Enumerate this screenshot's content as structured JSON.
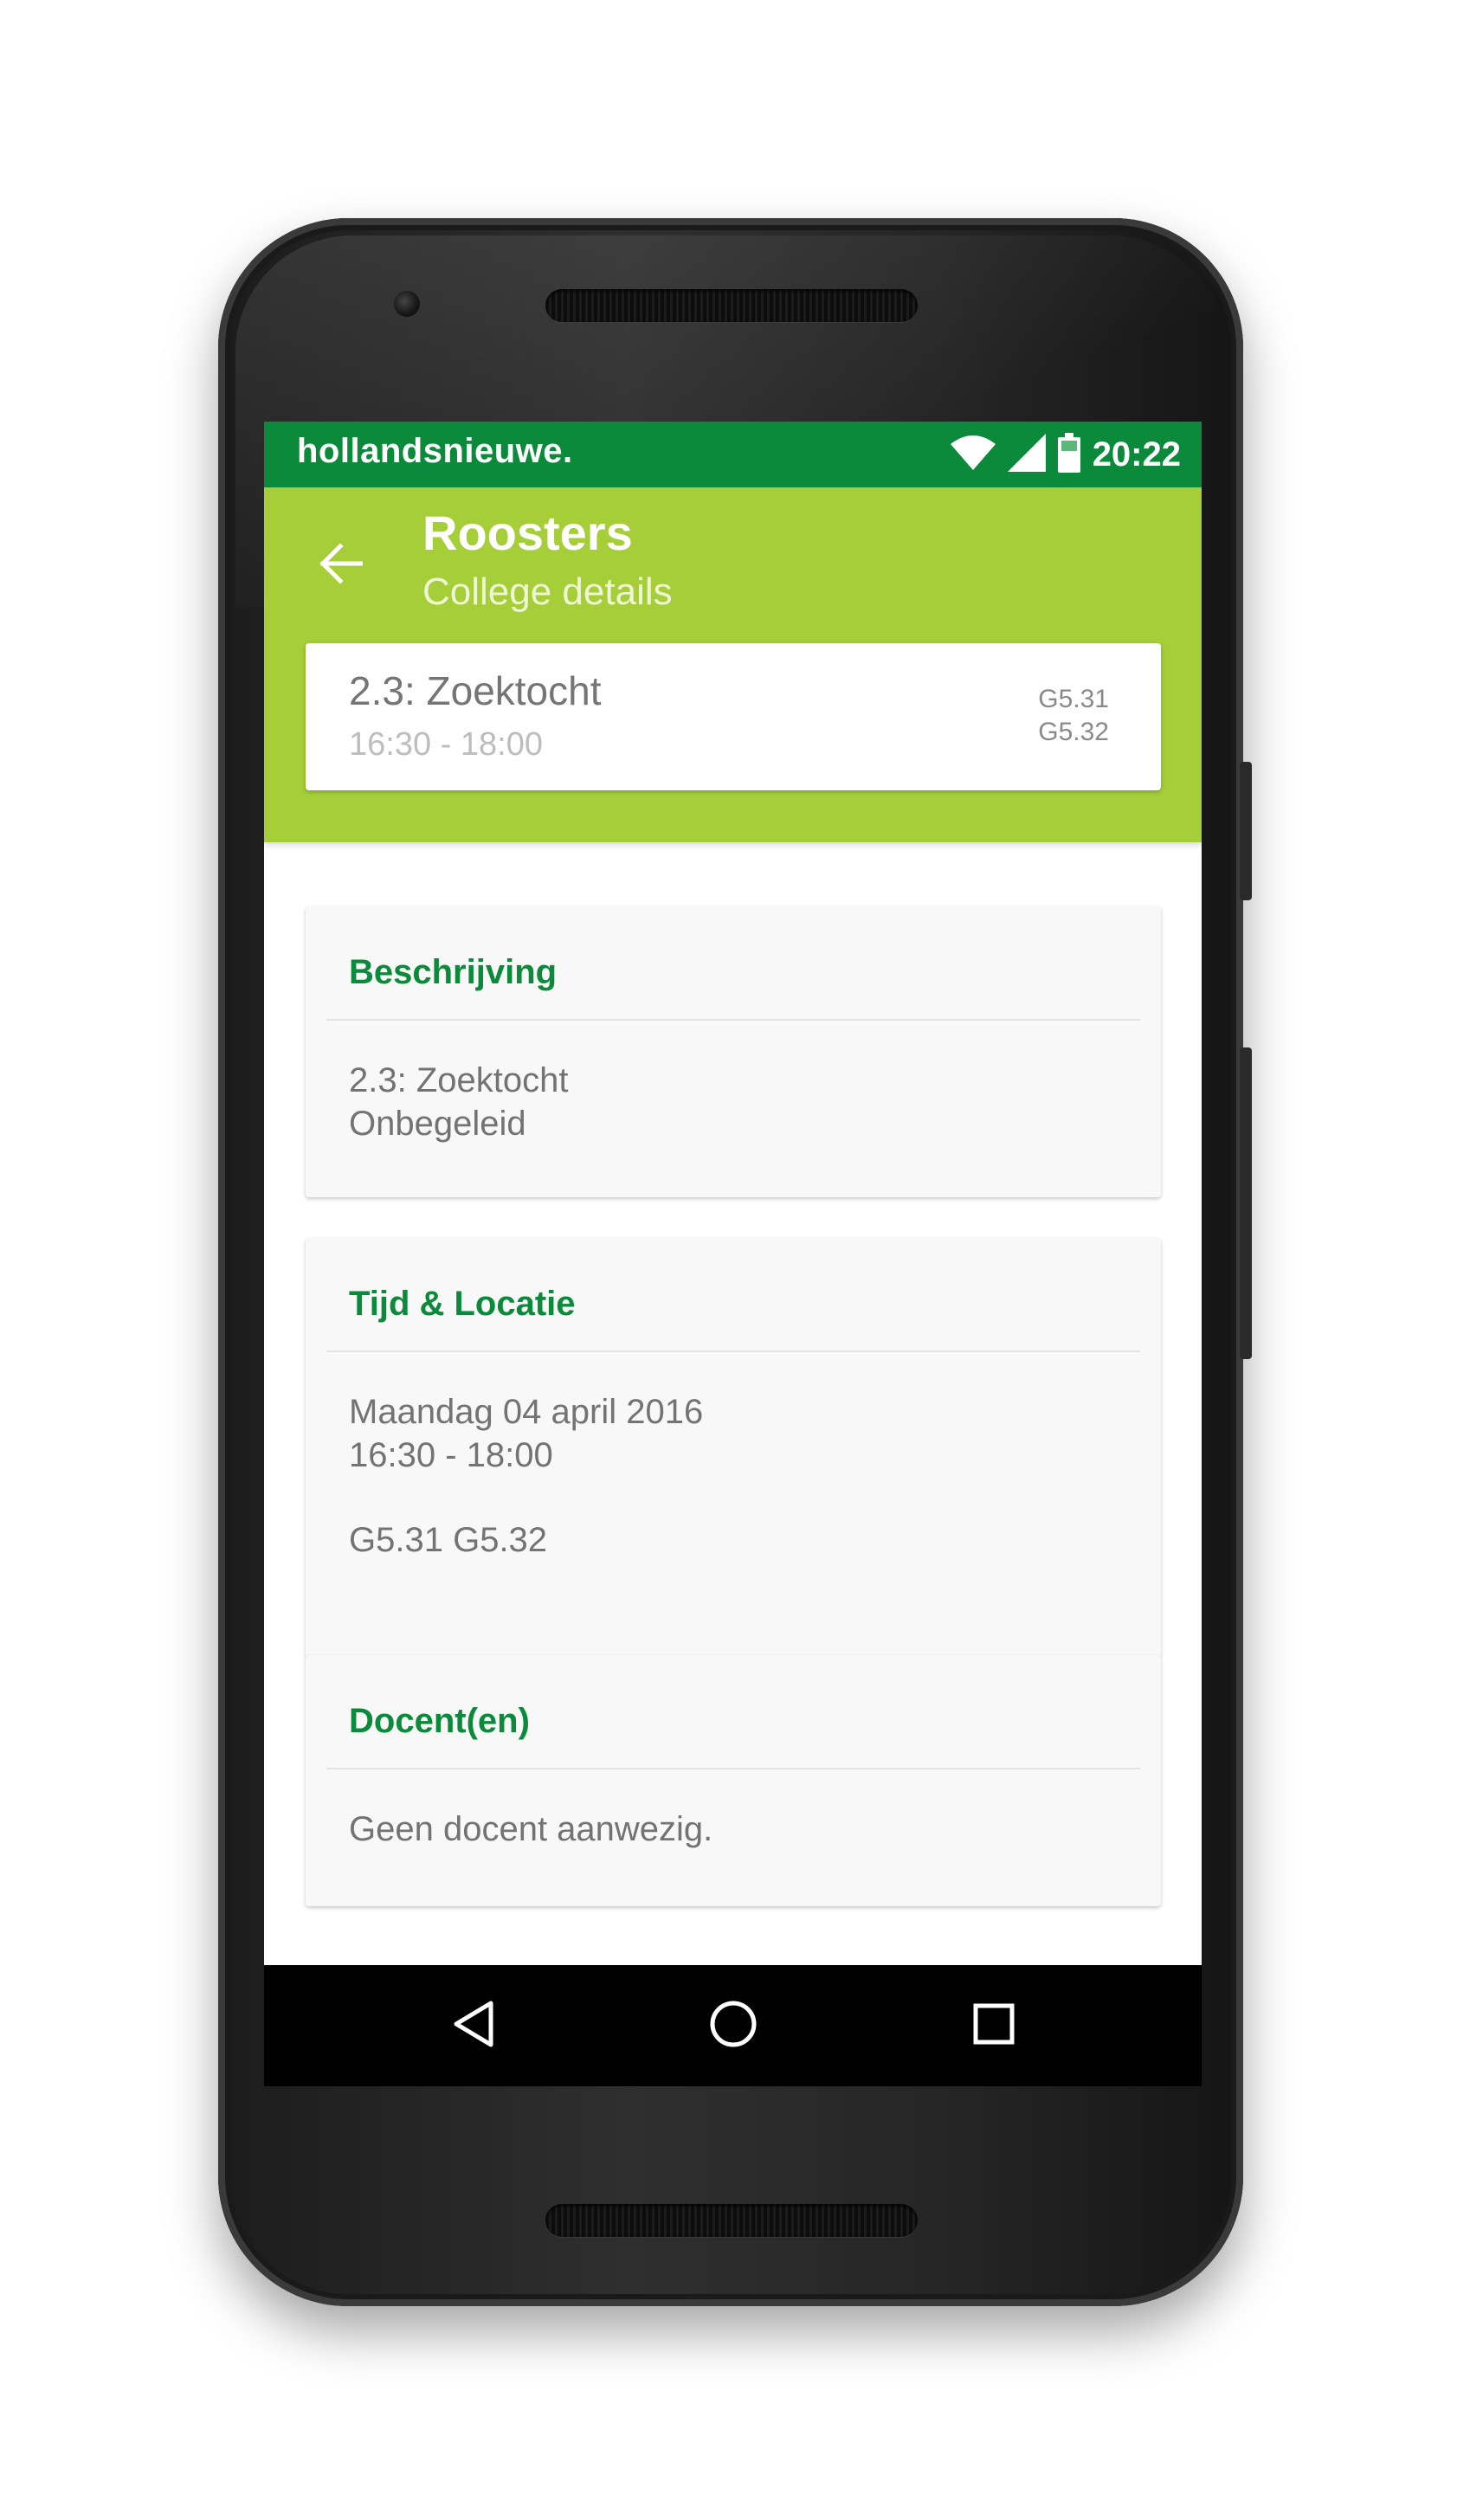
{
  "status_bar": {
    "carrier": "hollandsnieuwe.",
    "time": "20:22",
    "icons": [
      "wifi-icon",
      "signal-icon",
      "battery-icon"
    ]
  },
  "app_bar": {
    "back_icon": "arrow-left-icon",
    "title": "Roosters",
    "subtitle": "College details"
  },
  "summary": {
    "name": "2.3: Zoektocht",
    "time": "16:30 - 18:00",
    "rooms": [
      "G5.31",
      "G5.32"
    ]
  },
  "cards": {
    "description": {
      "title": "Beschrijving",
      "lines": [
        "2.3: Zoektocht",
        "Onbegeleid"
      ]
    },
    "time_location": {
      "title": "Tijd & Locatie",
      "date": "Maandag 04 april 2016",
      "time": "16:30 - 18:00",
      "rooms": "G5.31 G5.32"
    },
    "teachers": {
      "title": "Docent(en)",
      "text": "Geen docent aanwezig."
    }
  },
  "nav_bar": {
    "icons": [
      "back-triangle-icon",
      "home-circle-icon",
      "recents-square-icon"
    ]
  },
  "colors": {
    "status_bar": "#0a8a3a",
    "app_bar": "#a6ce39",
    "accent": "#0a8a3a"
  }
}
